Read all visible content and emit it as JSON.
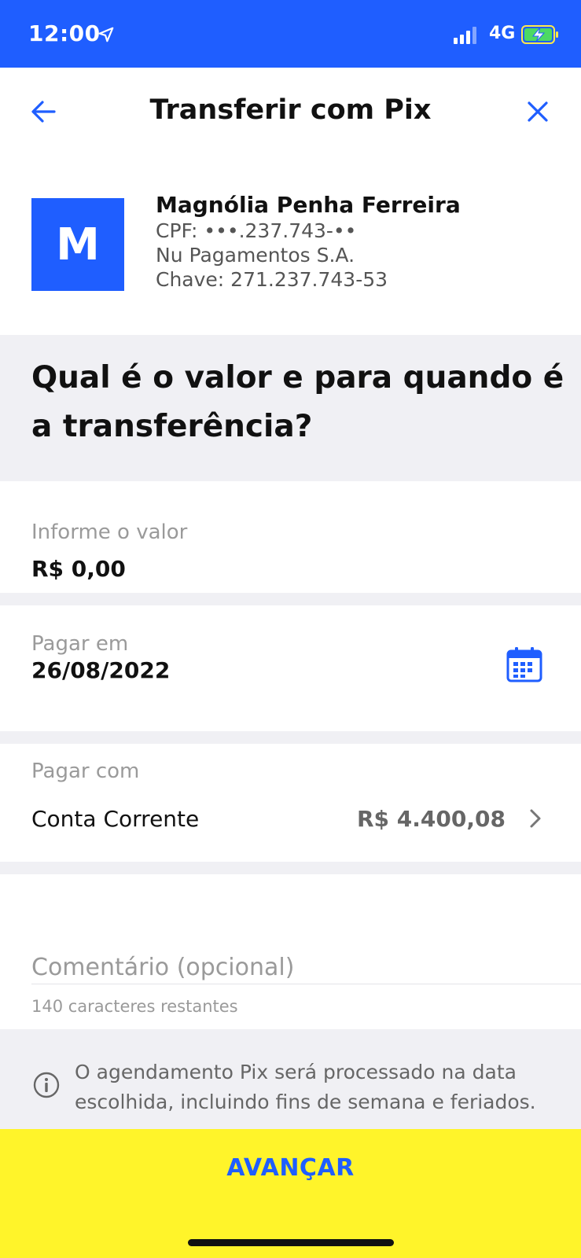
{
  "status_bar": {
    "time": "12:00",
    "network": "4G"
  },
  "nav": {
    "title": "Transferir com Pix"
  },
  "recipient": {
    "initial": "M",
    "name": "Magnólia Penha Ferreira",
    "cpf": "CPF: •••.237.743-••",
    "institution": "Nu Pagamentos S.A.",
    "key": "Chave: 271.237.743-53"
  },
  "question": "Qual é o valor e para quando é a transferência?",
  "amount": {
    "label": "Informe o valor",
    "value": "R$ 0,00"
  },
  "date": {
    "label": "Pagar em",
    "value": "26/08/2022"
  },
  "payment_source": {
    "label": "Pagar com",
    "account": "Conta Corrente",
    "balance": "R$ 4.400,08"
  },
  "comment": {
    "placeholder": "Comentário (opcional)",
    "counter": "140 caracteres restantes"
  },
  "notice": "O agendamento Pix será processado na data escolhida, incluindo fins de semana e feriados.",
  "cta": {
    "label": "AVANÇAR"
  },
  "colors": {
    "brand_blue": "#1f5eff",
    "cta_yellow": "#fff42a",
    "section_gray": "#f0f0f4"
  }
}
